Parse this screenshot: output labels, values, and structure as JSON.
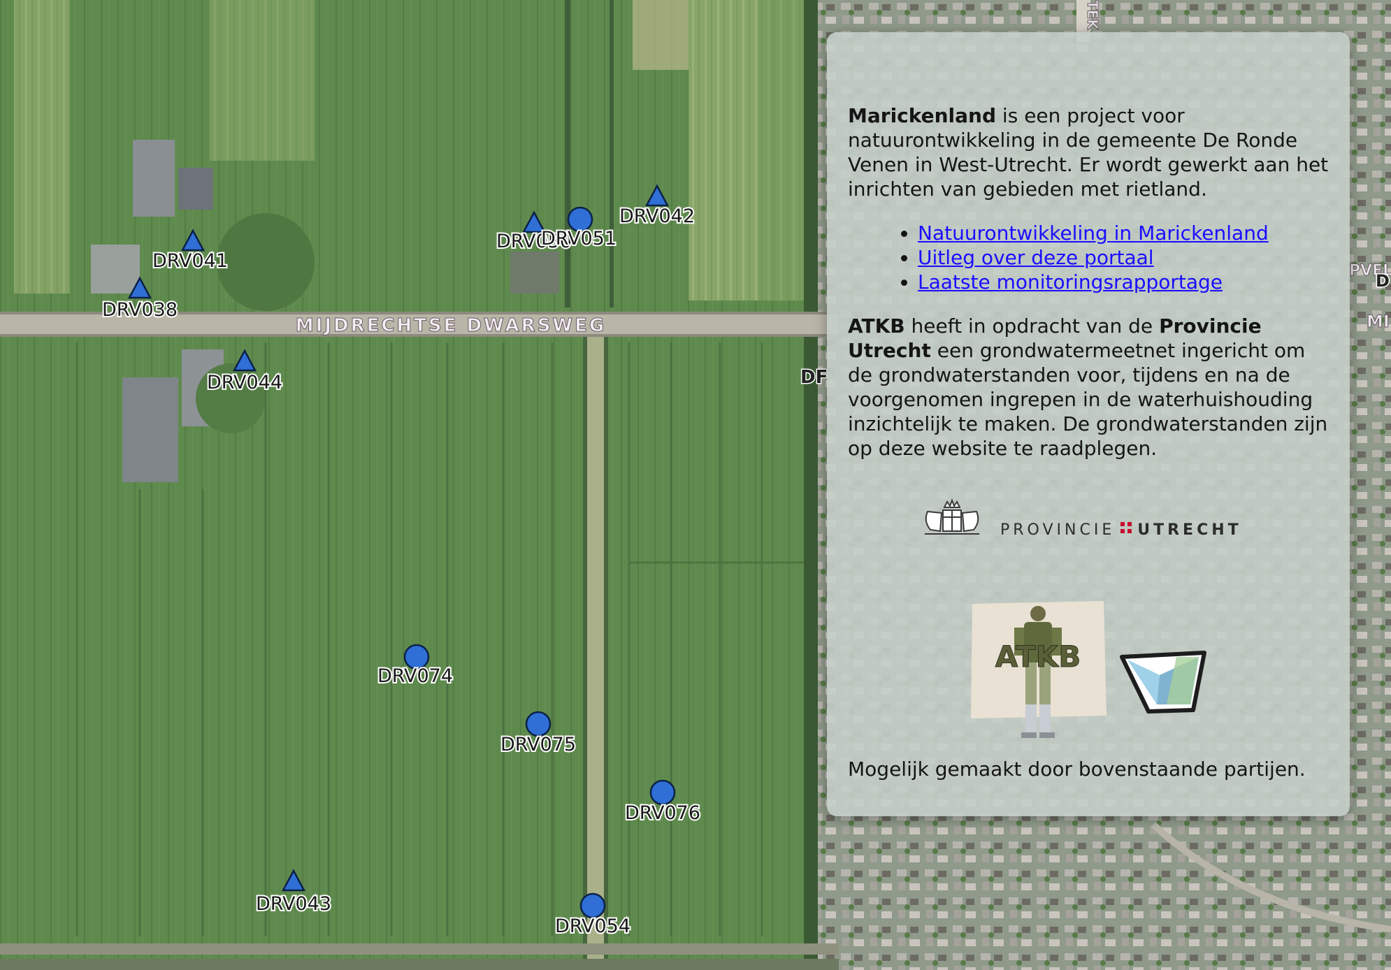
{
  "map": {
    "street_name": "MIJDRECHTSE DWARSWEG",
    "edge_labels": [
      "DF",
      "PVEL",
      "D",
      "MI",
      "TEK"
    ],
    "marker_color": "#2f6fd6",
    "stations": [
      {
        "id": "DRV041",
        "shape": "triangle"
      },
      {
        "id": "DRV038",
        "shape": "triangle"
      },
      {
        "id": "DRV044",
        "shape": "triangle"
      },
      {
        "id": "DRV050",
        "shape": "triangle"
      },
      {
        "id": "DRV051",
        "shape": "circle"
      },
      {
        "id": "DRV042",
        "shape": "triangle"
      },
      {
        "id": "DRV074",
        "shape": "circle"
      },
      {
        "id": "DRV075",
        "shape": "circle"
      },
      {
        "id": "DRV076",
        "shape": "circle"
      },
      {
        "id": "DRV043",
        "shape": "triangle"
      },
      {
        "id": "DRV054",
        "shape": "circle"
      }
    ]
  },
  "panel": {
    "intro": {
      "bold": "Marickenland",
      "rest": " is een project voor natuurontwikkeling in de gemeente De Ronde Venen in West-Utrecht. Er wordt gewerkt aan het inrichten van gebieden met rietland."
    },
    "links": [
      "Natuurontwikkeling in Marickenland",
      "Uitleg over deze portaal",
      "Laatste monitoringsrapportage"
    ],
    "atkb_paragraph": {
      "bold1": "ATKB",
      "text1": " heeft in opdracht van de ",
      "bold2": "Provincie Utrecht",
      "text2": " een grondwatermeetnet ingericht om de grondwaterstanden voor, tijdens en na de voorgenomen ingrepen in de waterhuishouding inzichtelijk te maken. De grondwaterstanden zijn op deze website te raadplegen."
    },
    "provincie_logo": {
      "word1": "PROVINCIE",
      "word2": "UTRECHT",
      "dots_color": "#c8102e"
    },
    "atkb_logo_text": "ATKB",
    "footer": "Mogelijk gemaakt door bovenstaande partijen."
  }
}
